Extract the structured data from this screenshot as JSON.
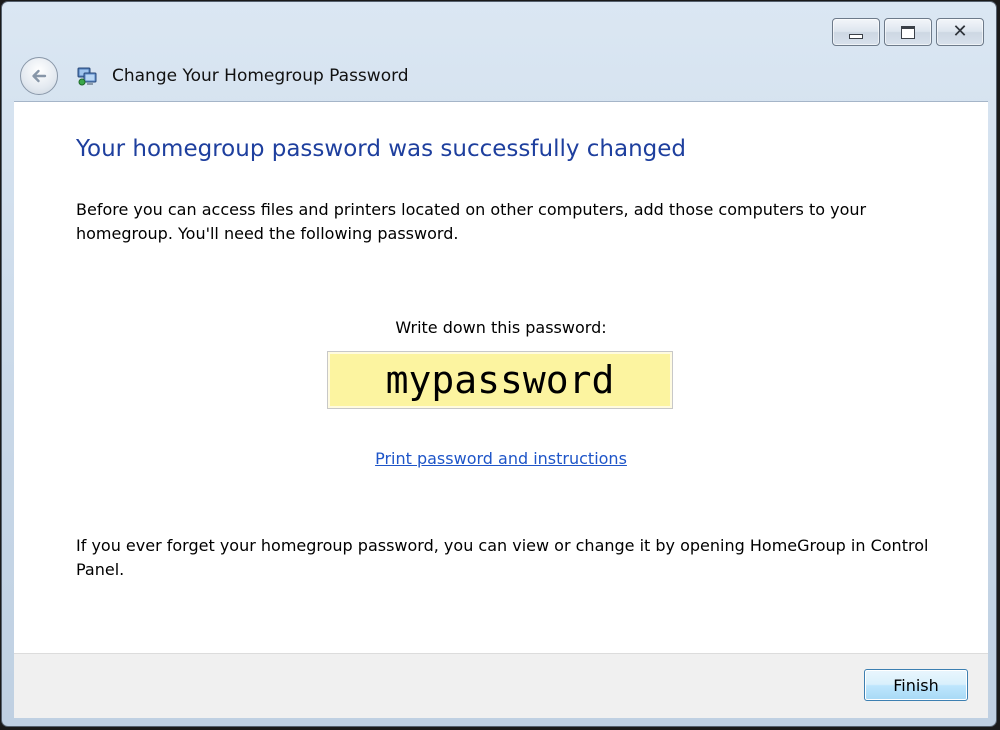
{
  "window": {
    "title": "Change Your Homegroup Password",
    "caption_buttons": {
      "minimize_icon": "minimize-icon",
      "maximize_icon": "maximize-icon",
      "close_icon": "close-icon",
      "close_glyph": "✕"
    }
  },
  "nav": {
    "back_icon": "back-arrow-icon",
    "title_icon": "homegroup-icon"
  },
  "content": {
    "headline": "Your homegroup password was successfully changed",
    "intro": "Before you can access files and printers located on other computers, add those computers to your homegroup. You'll need the following password.",
    "write_label": "Write down this password:",
    "password": "mypassword",
    "print_link": "Print password and instructions",
    "forget_note": "If you ever forget your homegroup password, you can view or change it by opening HomeGroup in Control Panel."
  },
  "footer": {
    "finish_label": "Finish"
  },
  "colors": {
    "headline": "#1e3f9e",
    "link": "#1e55c8",
    "password_bg": "#fcf4a0",
    "content_bg": "#ffffff",
    "footer_bg": "#f0f0f0"
  }
}
